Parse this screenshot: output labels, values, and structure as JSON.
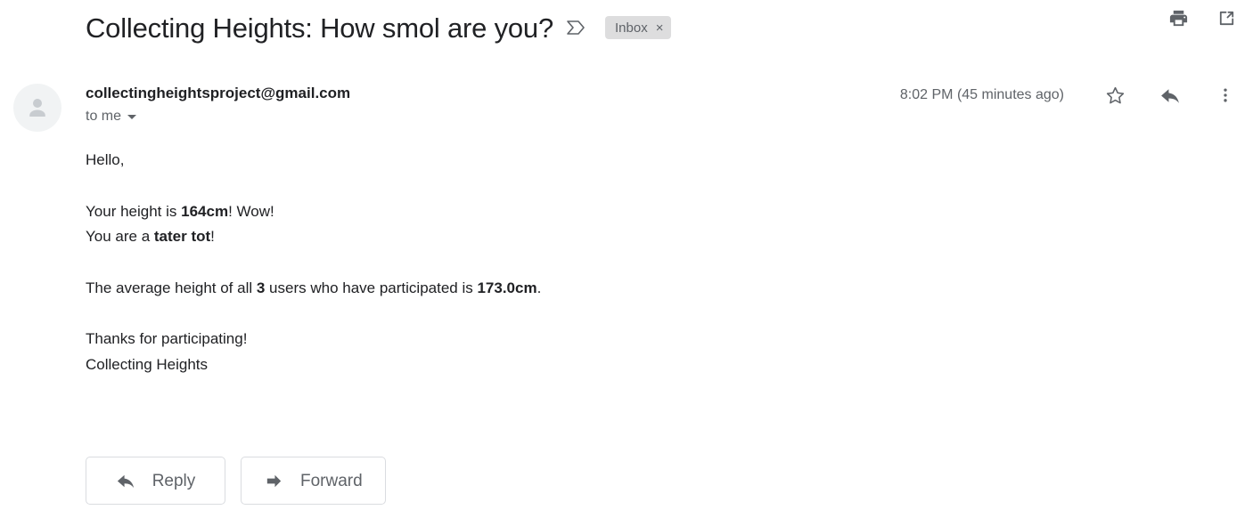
{
  "header": {
    "subject": "Collecting Heights: How smol are you?",
    "label_arrow_icon": "label-arrow-icon",
    "inbox_chip": {
      "label": "Inbox",
      "remove": "×"
    },
    "print_icon": "print-icon",
    "open_in_new_icon": "open-in-new-window-icon"
  },
  "message": {
    "avatar_icon": "person-avatar-icon",
    "sender_email": "collectingheightsproject@gmail.com",
    "recipient": "to me",
    "details_caret_icon": "chevron-down-icon",
    "timestamp": "8:02 PM (45 minutes ago)",
    "star_icon": "star-outline-icon",
    "reply_icon": "reply-arrow-icon",
    "more_icon": "more-vertical-icon"
  },
  "body": {
    "greeting": "Hello,",
    "height_line_prefix": "Your height is ",
    "height_value": "164cm",
    "height_line_suffix": "! Wow!",
    "category_line_prefix": "You are a ",
    "category_value": "tater tot",
    "category_line_suffix": "!",
    "average_prefix": "The average height of all ",
    "average_user_count": "3",
    "average_middle": " users who have participated is ",
    "average_value": "173.0cm",
    "average_suffix": ".",
    "thanks": "Thanks for participating!",
    "signature": "Collecting Heights"
  },
  "actions": {
    "reply_label": "Reply",
    "reply_icon": "reply-arrow-icon",
    "forward_label": "Forward",
    "forward_icon": "forward-arrow-icon"
  },
  "colors": {
    "text_primary": "#202124",
    "text_secondary": "#5f6368",
    "chip_background": "#ddddde",
    "border": "#dadce0",
    "avatar_background": "#f1f3f4",
    "page_background": "#ffffff"
  }
}
